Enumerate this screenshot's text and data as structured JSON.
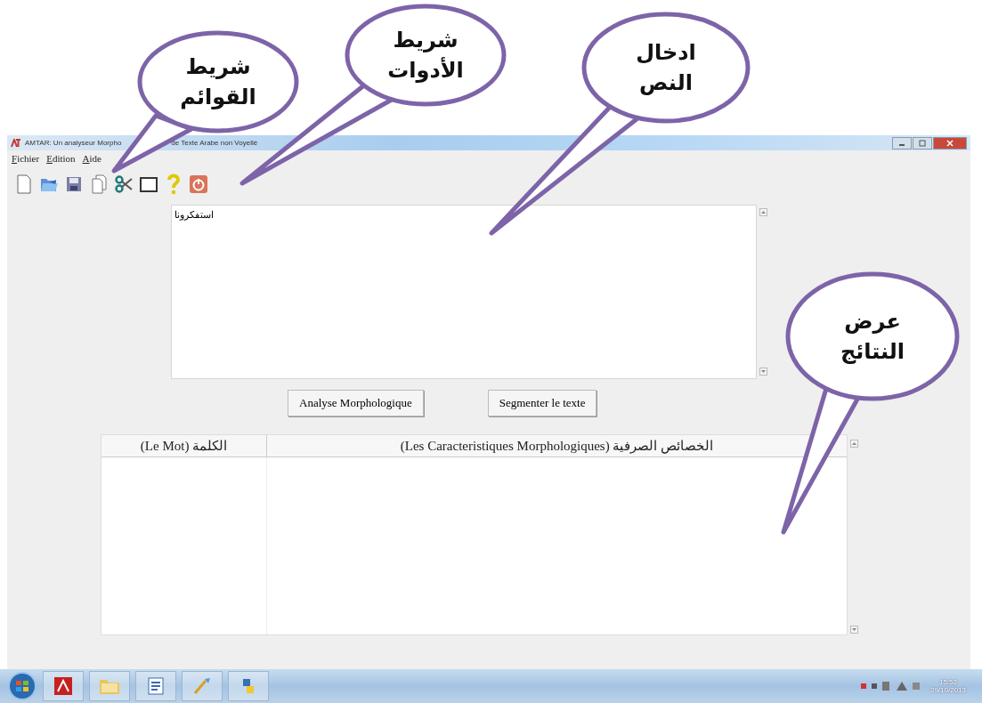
{
  "window": {
    "title_parts": [
      "de Texte Arabe non Voyellé",
      "AMTAR: Un analyseur Morpho"
    ]
  },
  "menu": [
    {
      "mnemonic": "A",
      "rest": "ide"
    },
    {
      "mnemonic": "E",
      "rest": "dition"
    },
    {
      "mnemonic": "F",
      "rest": "ichier"
    }
  ],
  "toolbar": [
    {
      "kind": "new"
    },
    {
      "kind": "open"
    },
    {
      "kind": "save"
    },
    {
      "kind": "copy"
    },
    {
      "kind": "cut"
    },
    {
      "kind": "window"
    },
    {
      "kind": "help"
    },
    {
      "kind": "power"
    }
  ],
  "editor": {
    "value": "استفكرونا"
  },
  "buttons": [
    "Segmenter le texte",
    "Analyse Morphologique"
  ],
  "table": {
    "columns": [
      "(Les Caracteristiques Morphologiques) الخصائص الصرفية",
      "(Le Mot)  الكلمة"
    ]
  },
  "taskbar": {
    "apps": [
      {
        "kind": "pdf"
      },
      {
        "kind": "folder"
      },
      {
        "kind": "doc"
      },
      {
        "kind": "paint"
      },
      {
        "kind": "python"
      }
    ],
    "time": "15:52",
    "date": "29/10/2013"
  },
  "callouts": [
    {
      "text": "شريط\nالقوائم"
    },
    {
      "text": "شريط\nالأدوات"
    },
    {
      "text": "ادخال\nالنص"
    },
    {
      "text": "عرض\nالنتائج"
    }
  ]
}
